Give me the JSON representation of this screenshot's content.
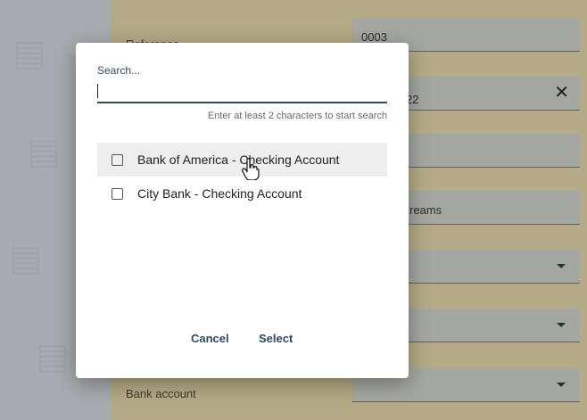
{
  "background_form": {
    "reference": {
      "label": "Reference",
      "value": "0003"
    },
    "date": {
      "value": "22",
      "clear_icon": "close-icon"
    },
    "description": {
      "value": "reams"
    },
    "bank_account": {
      "label": "Bank account"
    }
  },
  "modal": {
    "search": {
      "label": "Search...",
      "placeholder": "",
      "value": ""
    },
    "hint": "Enter at least 2 characters to start search",
    "items": [
      {
        "label": "Bank of America - Checking Account",
        "checked": false
      },
      {
        "label": "City Bank - Checking Account",
        "checked": false
      }
    ],
    "buttons": {
      "cancel": "Cancel",
      "select": "Select"
    }
  },
  "colors": {
    "accent": "#2e4a66",
    "form_bg": "#b4ab86",
    "hover_row": "#eeeeee"
  }
}
